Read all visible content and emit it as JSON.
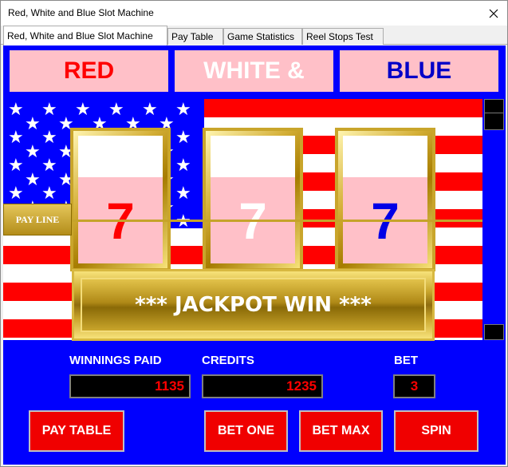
{
  "window": {
    "title": "Red, White and Blue Slot Machine"
  },
  "tabs": [
    {
      "label": "Red, White and Blue Slot Machine"
    },
    {
      "label": "Pay Table"
    },
    {
      "label": "Game Statistics"
    },
    {
      "label": "Reel Stops Test"
    }
  ],
  "banners": [
    {
      "text": "RED",
      "color": "#ff0000"
    },
    {
      "text": "WHITE &",
      "color": "#ffffff"
    },
    {
      "text": "BLUE",
      "color": "#0000c8"
    }
  ],
  "reels": [
    {
      "symbol": "7",
      "color": "#ff0000"
    },
    {
      "symbol": "7",
      "color": "#ffffff"
    },
    {
      "symbol": "7",
      "color": "#0000e6"
    }
  ],
  "payline_label": "PAY LINE",
  "win_message": "*** JACKPOT WIN ***",
  "stats": {
    "winnings_label": "WINNINGS PAID",
    "winnings_value": "1135",
    "credits_label": "CREDITS",
    "credits_value": "1235",
    "bet_label": "BET",
    "bet_value": "3"
  },
  "buttons": {
    "pay_table": "PAY TABLE",
    "bet_one": "BET ONE",
    "bet_max": "BET MAX",
    "spin": "SPIN"
  },
  "colors": {
    "flag_red": "#ff0000",
    "flag_white": "#ffffff",
    "flag_blue": "#0000fe",
    "gold": "#c9a52b",
    "reel_pink": "#ffc0c8"
  }
}
